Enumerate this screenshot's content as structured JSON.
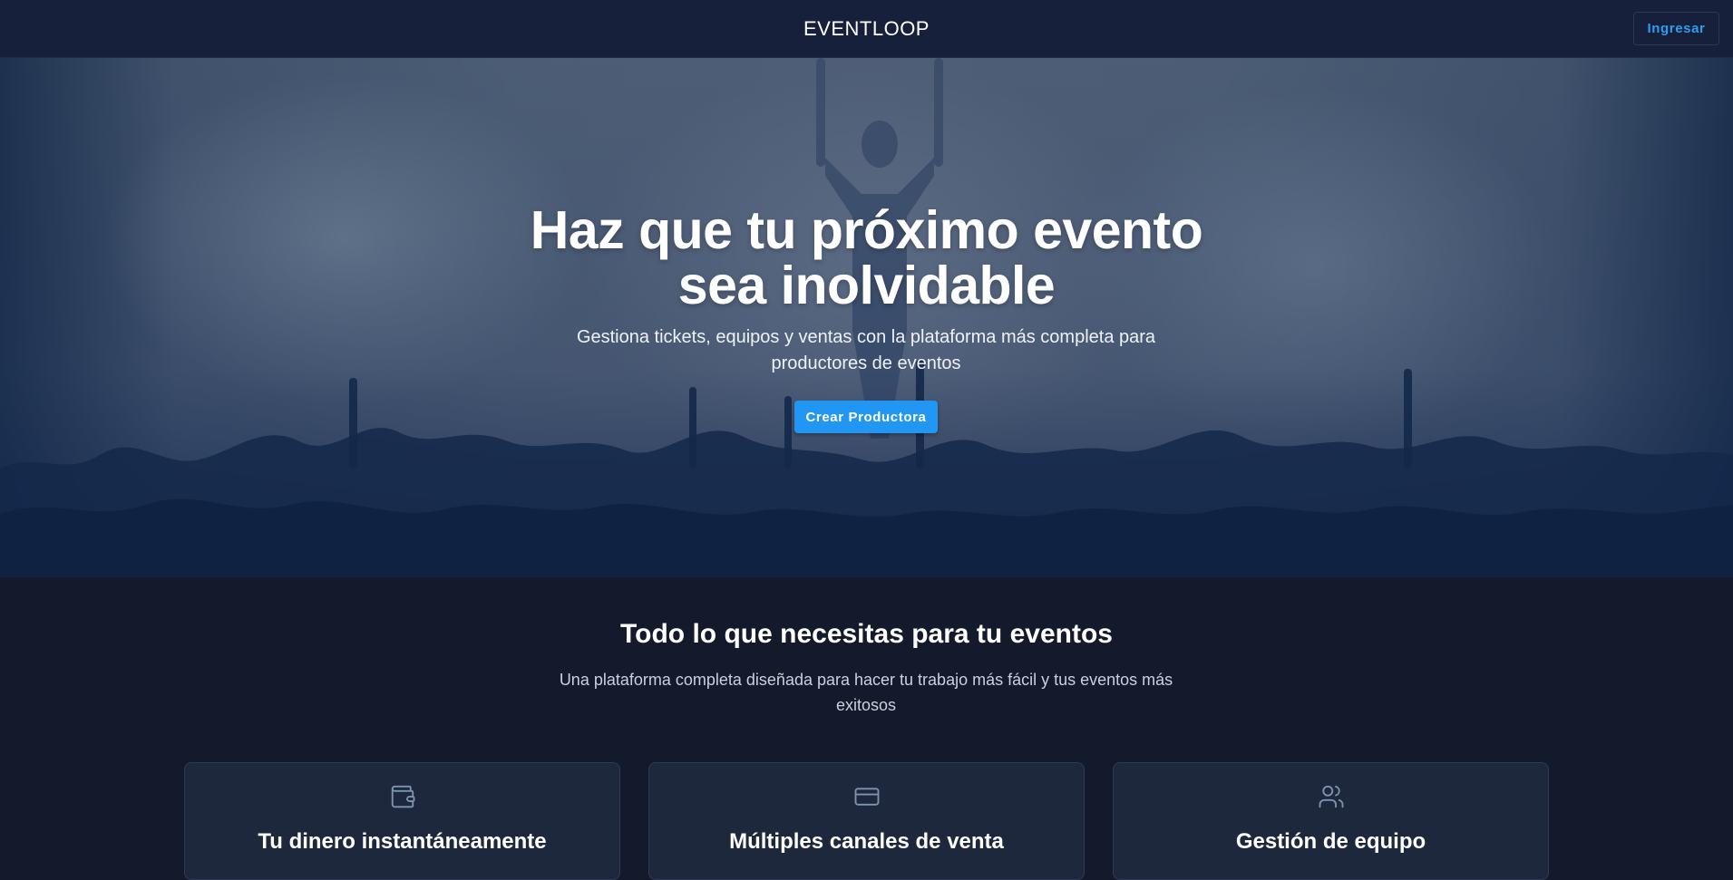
{
  "header": {
    "logo": "EVENTLOOP",
    "login_label": "Ingresar"
  },
  "hero": {
    "title_line1": "Haz que tu próximo evento",
    "title_line2": "sea inolvidable",
    "subtitle": "Gestiona tickets, equipos y ventas con la plataforma más completa para productores de eventos",
    "cta_label": "Crear Productora"
  },
  "features": {
    "title": "Todo lo que necesitas para tu eventos",
    "subtitle": "Una plataforma completa diseñada para hacer tu trabajo más fácil y tus eventos más exitosos",
    "cards": [
      {
        "icon": "wallet-icon",
        "title": "Tu dinero instantáneamente"
      },
      {
        "icon": "credit-card-icon",
        "title": "Múltiples canales de venta"
      },
      {
        "icon": "users-icon",
        "title": "Gestión de equipo"
      }
    ]
  },
  "colors": {
    "accent": "#2196f3",
    "link": "#2f9cf0",
    "background": "#121a2c",
    "navbar": "#16203a",
    "card": "#1d283c",
    "icon": "#7f93ad"
  }
}
